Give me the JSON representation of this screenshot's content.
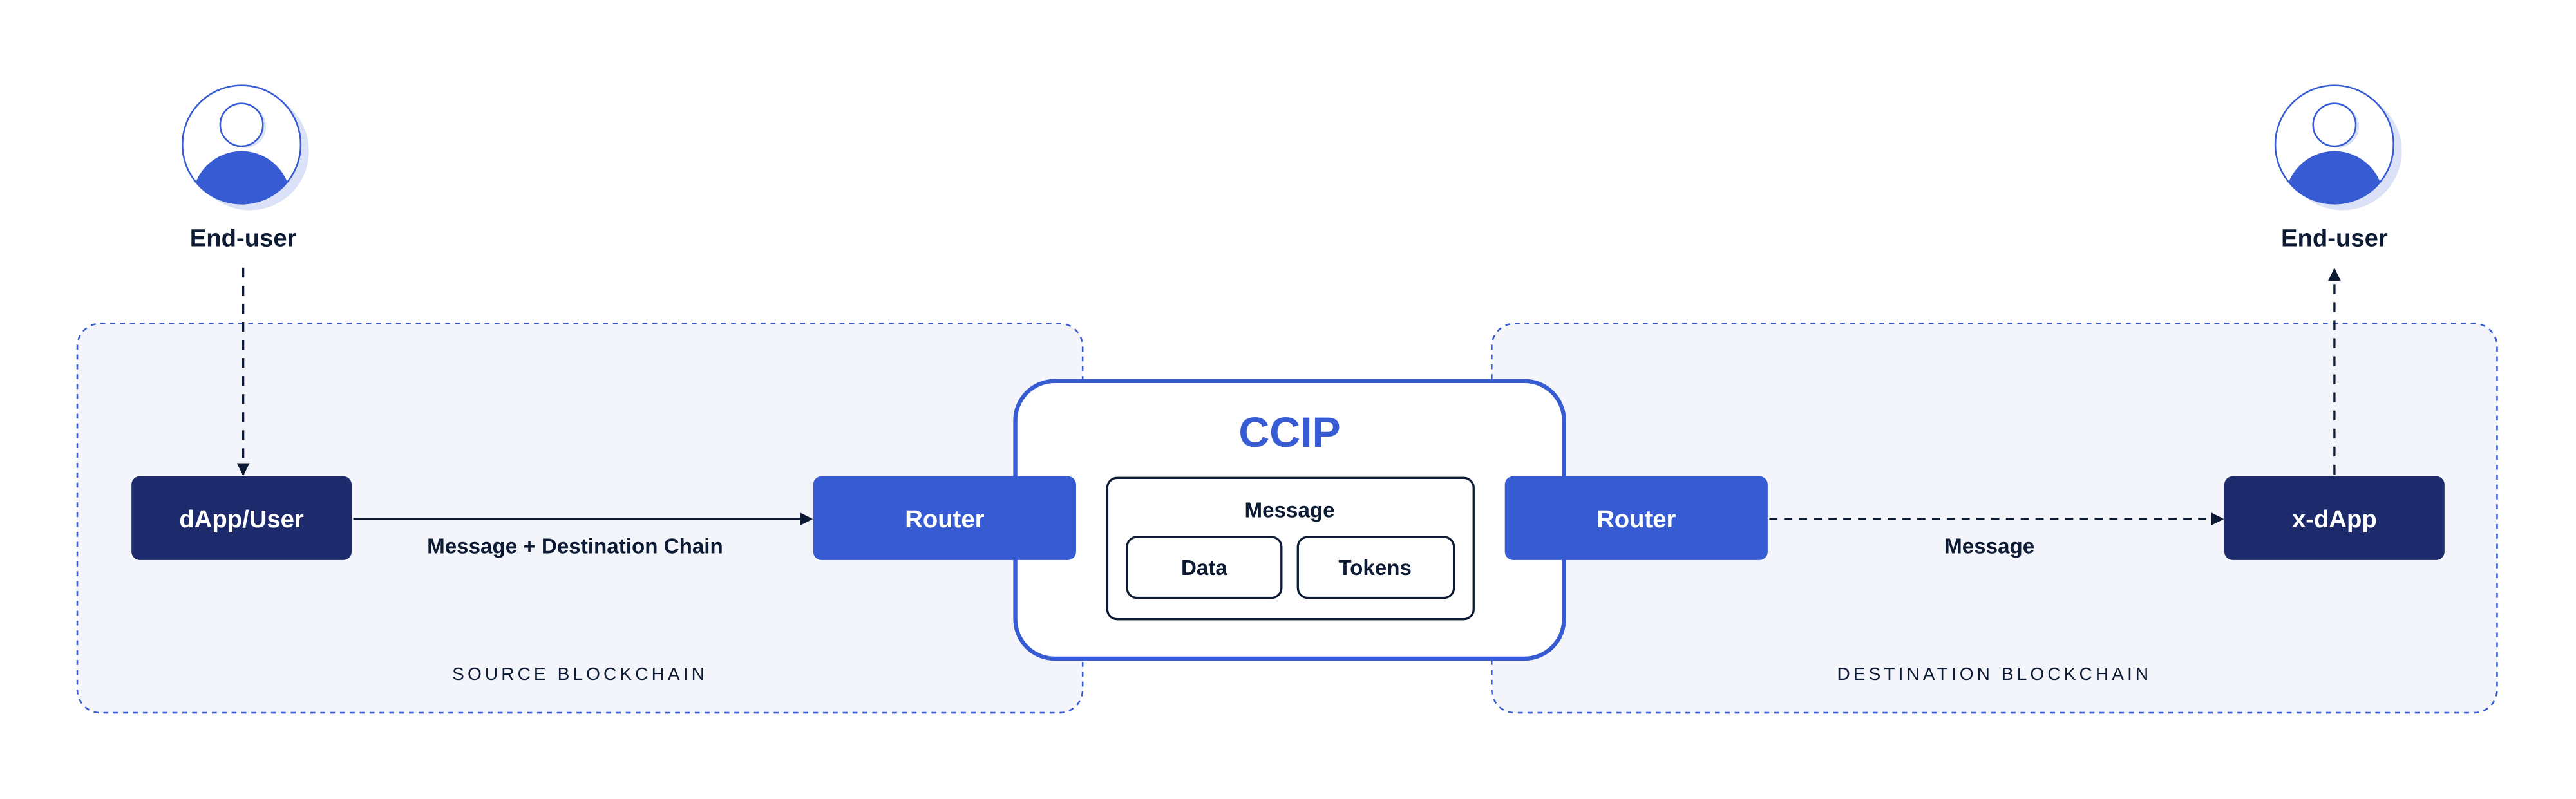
{
  "colors": {
    "accent": "#375bd2",
    "navy": "#1d2a6b",
    "ink": "#0d1a33",
    "zone_fill": "#f3f5fa",
    "shadow": "#dbe2f7"
  },
  "users": {
    "source": {
      "label": "End-user",
      "icon": "user-avatar-icon"
    },
    "destination": {
      "label": "End-user",
      "icon": "user-avatar-icon"
    }
  },
  "zones": {
    "source": {
      "label": "SOURCE BLOCKCHAIN"
    },
    "destination": {
      "label": "DESTINATION BLOCKCHAIN"
    }
  },
  "nodes": {
    "dapp_user": "dApp/User",
    "router_source": "Router",
    "router_destination": "Router",
    "x_dapp": "x-dApp"
  },
  "ccip": {
    "title": "CCIP",
    "message": {
      "label": "Message",
      "parts": [
        "Data",
        "Tokens"
      ]
    }
  },
  "edges": {
    "user_to_dapp": {
      "style": "dashed"
    },
    "dapp_to_router": {
      "label": "Message + Destination Chain",
      "style": "solid"
    },
    "router_to_xdapp": {
      "label": "Message",
      "style": "dashed"
    },
    "xdapp_to_user": {
      "style": "dashed"
    }
  }
}
